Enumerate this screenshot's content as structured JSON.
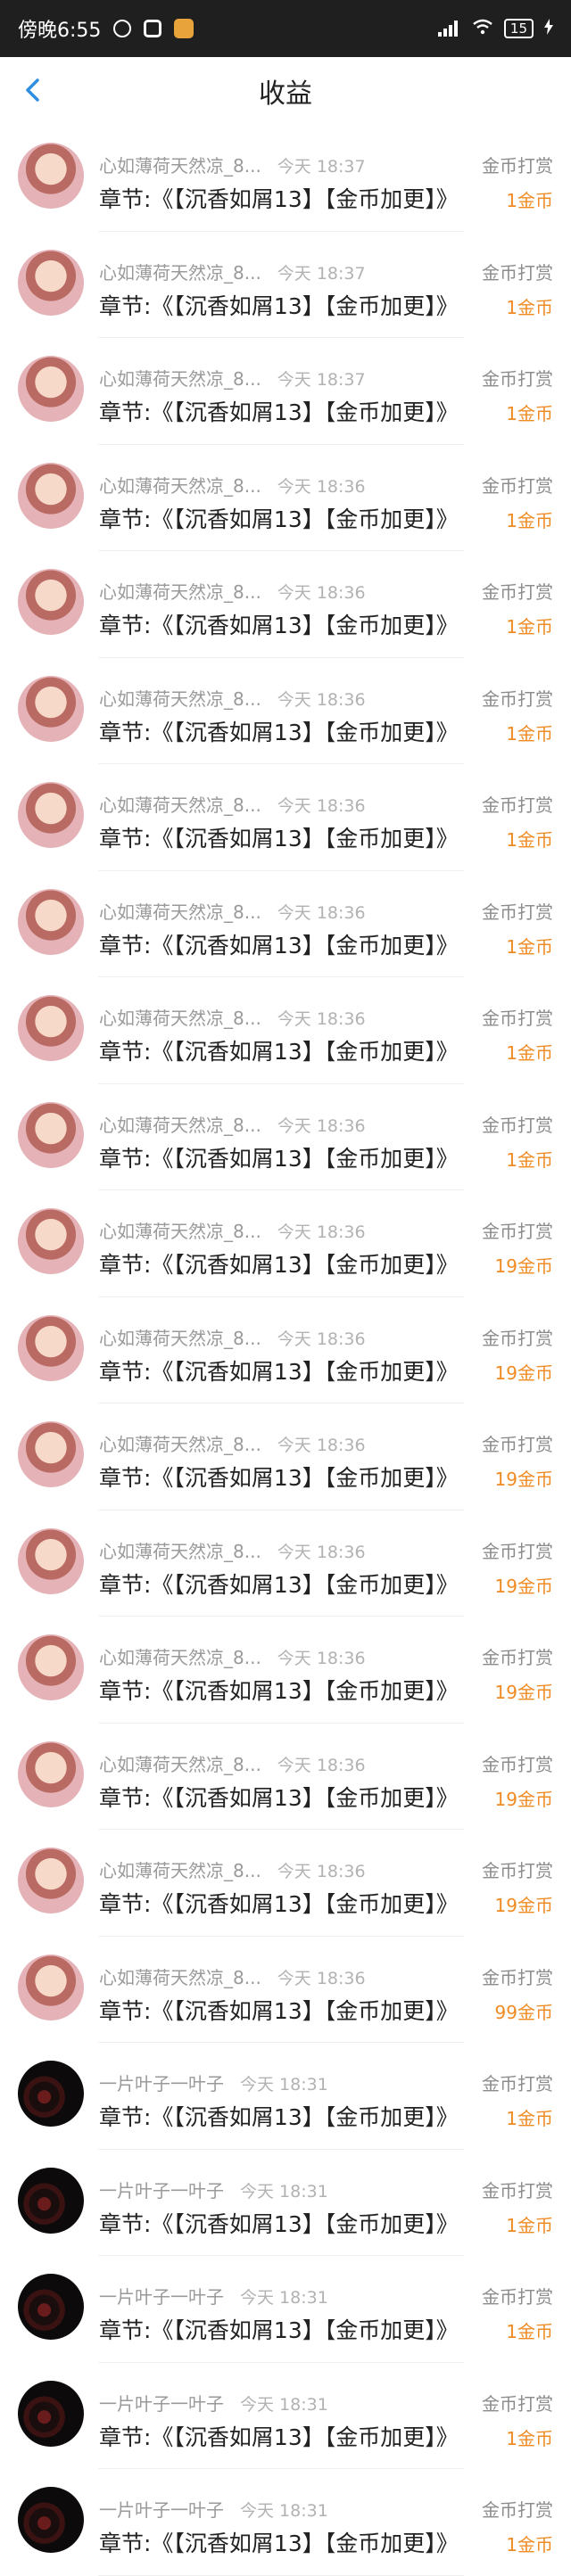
{
  "status_bar": {
    "time": "傍晚6:55",
    "battery": "15"
  },
  "header": {
    "title": "收益"
  },
  "records": [
    {
      "avatar": "girl",
      "name": "心如薄荷天然凉_8...",
      "time": "今天 18:37",
      "chapter": "章节:《【沉香如屑13】【金币加更】》",
      "type": "金币打赏",
      "amount": "1金币"
    },
    {
      "avatar": "girl",
      "name": "心如薄荷天然凉_8...",
      "time": "今天 18:37",
      "chapter": "章节:《【沉香如屑13】【金币加更】》",
      "type": "金币打赏",
      "amount": "1金币"
    },
    {
      "avatar": "girl",
      "name": "心如薄荷天然凉_8...",
      "time": "今天 18:37",
      "chapter": "章节:《【沉香如屑13】【金币加更】》",
      "type": "金币打赏",
      "amount": "1金币"
    },
    {
      "avatar": "girl",
      "name": "心如薄荷天然凉_8...",
      "time": "今天 18:36",
      "chapter": "章节:《【沉香如屑13】【金币加更】》",
      "type": "金币打赏",
      "amount": "1金币"
    },
    {
      "avatar": "girl",
      "name": "心如薄荷天然凉_8...",
      "time": "今天 18:36",
      "chapter": "章节:《【沉香如屑13】【金币加更】》",
      "type": "金币打赏",
      "amount": "1金币"
    },
    {
      "avatar": "girl",
      "name": "心如薄荷天然凉_8...",
      "time": "今天 18:36",
      "chapter": "章节:《【沉香如屑13】【金币加更】》",
      "type": "金币打赏",
      "amount": "1金币"
    },
    {
      "avatar": "girl",
      "name": "心如薄荷天然凉_8...",
      "time": "今天 18:36",
      "chapter": "章节:《【沉香如屑13】【金币加更】》",
      "type": "金币打赏",
      "amount": "1金币"
    },
    {
      "avatar": "girl",
      "name": "心如薄荷天然凉_8...",
      "time": "今天 18:36",
      "chapter": "章节:《【沉香如屑13】【金币加更】》",
      "type": "金币打赏",
      "amount": "1金币"
    },
    {
      "avatar": "girl",
      "name": "心如薄荷天然凉_8...",
      "time": "今天 18:36",
      "chapter": "章节:《【沉香如屑13】【金币加更】》",
      "type": "金币打赏",
      "amount": "1金币"
    },
    {
      "avatar": "girl",
      "name": "心如薄荷天然凉_8...",
      "time": "今天 18:36",
      "chapter": "章节:《【沉香如屑13】【金币加更】》",
      "type": "金币打赏",
      "amount": "1金币"
    },
    {
      "avatar": "girl",
      "name": "心如薄荷天然凉_8...",
      "time": "今天 18:36",
      "chapter": "章节:《【沉香如屑13】【金币加更】》",
      "type": "金币打赏",
      "amount": "19金币"
    },
    {
      "avatar": "girl",
      "name": "心如薄荷天然凉_8...",
      "time": "今天 18:36",
      "chapter": "章节:《【沉香如屑13】【金币加更】》",
      "type": "金币打赏",
      "amount": "19金币"
    },
    {
      "avatar": "girl",
      "name": "心如薄荷天然凉_8...",
      "time": "今天 18:36",
      "chapter": "章节:《【沉香如屑13】【金币加更】》",
      "type": "金币打赏",
      "amount": "19金币"
    },
    {
      "avatar": "girl",
      "name": "心如薄荷天然凉_8...",
      "time": "今天 18:36",
      "chapter": "章节:《【沉香如屑13】【金币加更】》",
      "type": "金币打赏",
      "amount": "19金币"
    },
    {
      "avatar": "girl",
      "name": "心如薄荷天然凉_8...",
      "time": "今天 18:36",
      "chapter": "章节:《【沉香如屑13】【金币加更】》",
      "type": "金币打赏",
      "amount": "19金币"
    },
    {
      "avatar": "girl",
      "name": "心如薄荷天然凉_8...",
      "time": "今天 18:36",
      "chapter": "章节:《【沉香如屑13】【金币加更】》",
      "type": "金币打赏",
      "amount": "19金币"
    },
    {
      "avatar": "girl",
      "name": "心如薄荷天然凉_8...",
      "time": "今天 18:36",
      "chapter": "章节:《【沉香如屑13】【金币加更】》",
      "type": "金币打赏",
      "amount": "19金币"
    },
    {
      "avatar": "girl",
      "name": "心如薄荷天然凉_8...",
      "time": "今天 18:36",
      "chapter": "章节:《【沉香如屑13】【金币加更】》",
      "type": "金币打赏",
      "amount": "99金币"
    },
    {
      "avatar": "dark",
      "name": "一片叶子一叶子",
      "time": "今天 18:31",
      "chapter": "章节:《【沉香如屑13】【金币加更】》",
      "type": "金币打赏",
      "amount": "1金币"
    },
    {
      "avatar": "dark",
      "name": "一片叶子一叶子",
      "time": "今天 18:31",
      "chapter": "章节:《【沉香如屑13】【金币加更】》",
      "type": "金币打赏",
      "amount": "1金币"
    },
    {
      "avatar": "dark",
      "name": "一片叶子一叶子",
      "time": "今天 18:31",
      "chapter": "章节:《【沉香如屑13】【金币加更】》",
      "type": "金币打赏",
      "amount": "1金币"
    },
    {
      "avatar": "dark",
      "name": "一片叶子一叶子",
      "time": "今天 18:31",
      "chapter": "章节:《【沉香如屑13】【金币加更】》",
      "type": "金币打赏",
      "amount": "1金币"
    },
    {
      "avatar": "dark",
      "name": "一片叶子一叶子",
      "time": "今天 18:31",
      "chapter": "章节:《【沉香如屑13】【金币加更】》",
      "type": "金币打赏",
      "amount": "1金币"
    }
  ]
}
